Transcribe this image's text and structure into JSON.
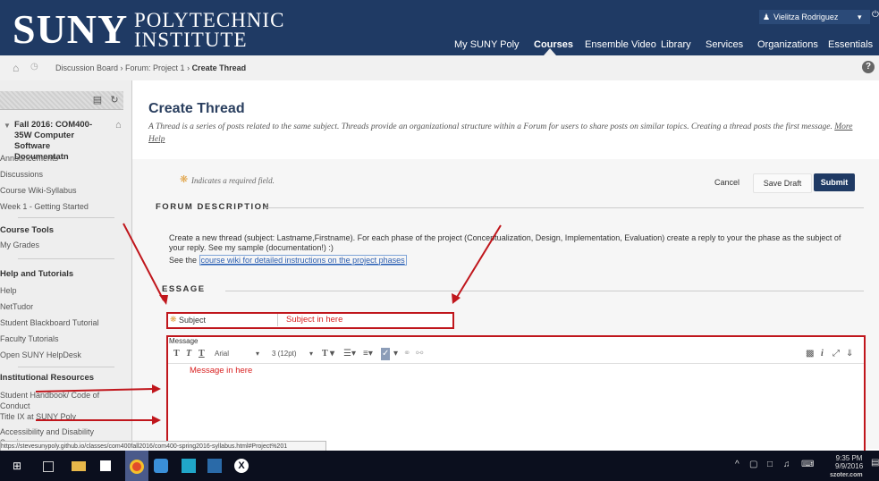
{
  "header": {
    "logo_suny": "SUNY",
    "logo_poly_line1": "POLYTECHNIC",
    "logo_poly_line2": "INSTITUTE",
    "nav": [
      "My SUNY Poly",
      "Courses",
      "Ensemble Video",
      "Library",
      "Services",
      "Organizations",
      "Essentials"
    ],
    "active_nav": "Courses",
    "user_name": "Vielitza Rodriguez"
  },
  "breadcrumb": {
    "items": [
      "Discussion Board",
      "Forum: Project 1",
      "Create Thread"
    ]
  },
  "sidebar": {
    "course_title": "Fall 2016: COM400-35W Computer Software Documentatn",
    "course_links": [
      "Announcements",
      "Discussions",
      "Course Wiki-Syllabus",
      "Week 1 - Getting Started"
    ],
    "course_tools_heading": "Course Tools",
    "course_tools_links": [
      "My Grades"
    ],
    "help_heading": "Help and Tutorials",
    "help_links": [
      "Help",
      "NetTudor",
      "Student Blackboard Tutorial",
      "Faculty Tutorials",
      "Open SUNY HelpDesk"
    ],
    "institutional_heading": "Institutional Resources",
    "institutional_links": [
      "Student Handbook/ Code of Conduct",
      "Title IX at SUNY Poly",
      "Accessibility and Disability Services"
    ]
  },
  "main": {
    "title": "Create Thread",
    "description": "A Thread is a series of posts related to the same subject. Threads provide an organizational structure within a Forum for users to share posts on similar topics. Creating a thread posts the first message.",
    "more_help": "More Help",
    "required_note": "Indicates a required field.",
    "cancel_label": "Cancel",
    "save_draft_label": "Save Draft",
    "submit_label": "Submit",
    "forum_description_heading": "FORUM DESCRIPTION",
    "forum_text": "Create a new thread (subject: Lastname,Firstname). For each phase of the project (Conceptualization, Design, Implementation, Evaluation) create a reply to your the phase as the subject of your reply. See my sample (documentation!) :)",
    "see_the": "See the",
    "wiki_link": "course wiki for detailed instructions on the project phases",
    "message_heading": "ESSAGE",
    "subject_label": "Subject",
    "subject_annotation": "Subject in here",
    "message_label": "Message",
    "font_family": "Arial",
    "font_size": "3 (12pt)",
    "message_annotation": "Message in here"
  },
  "status_bar": {
    "url": "https://stevesunypoly.github.io/classes/com400fall2016/com400-spring2016-syllabus.html#Project%201"
  },
  "taskbar": {
    "time": "9:35 PM",
    "date": "9/9/2016"
  },
  "watermark": "szoter.com",
  "colors": {
    "header_bg": "#1f3a64",
    "annotation_red": "#c0161c",
    "submit_bg": "#1f3a64"
  }
}
